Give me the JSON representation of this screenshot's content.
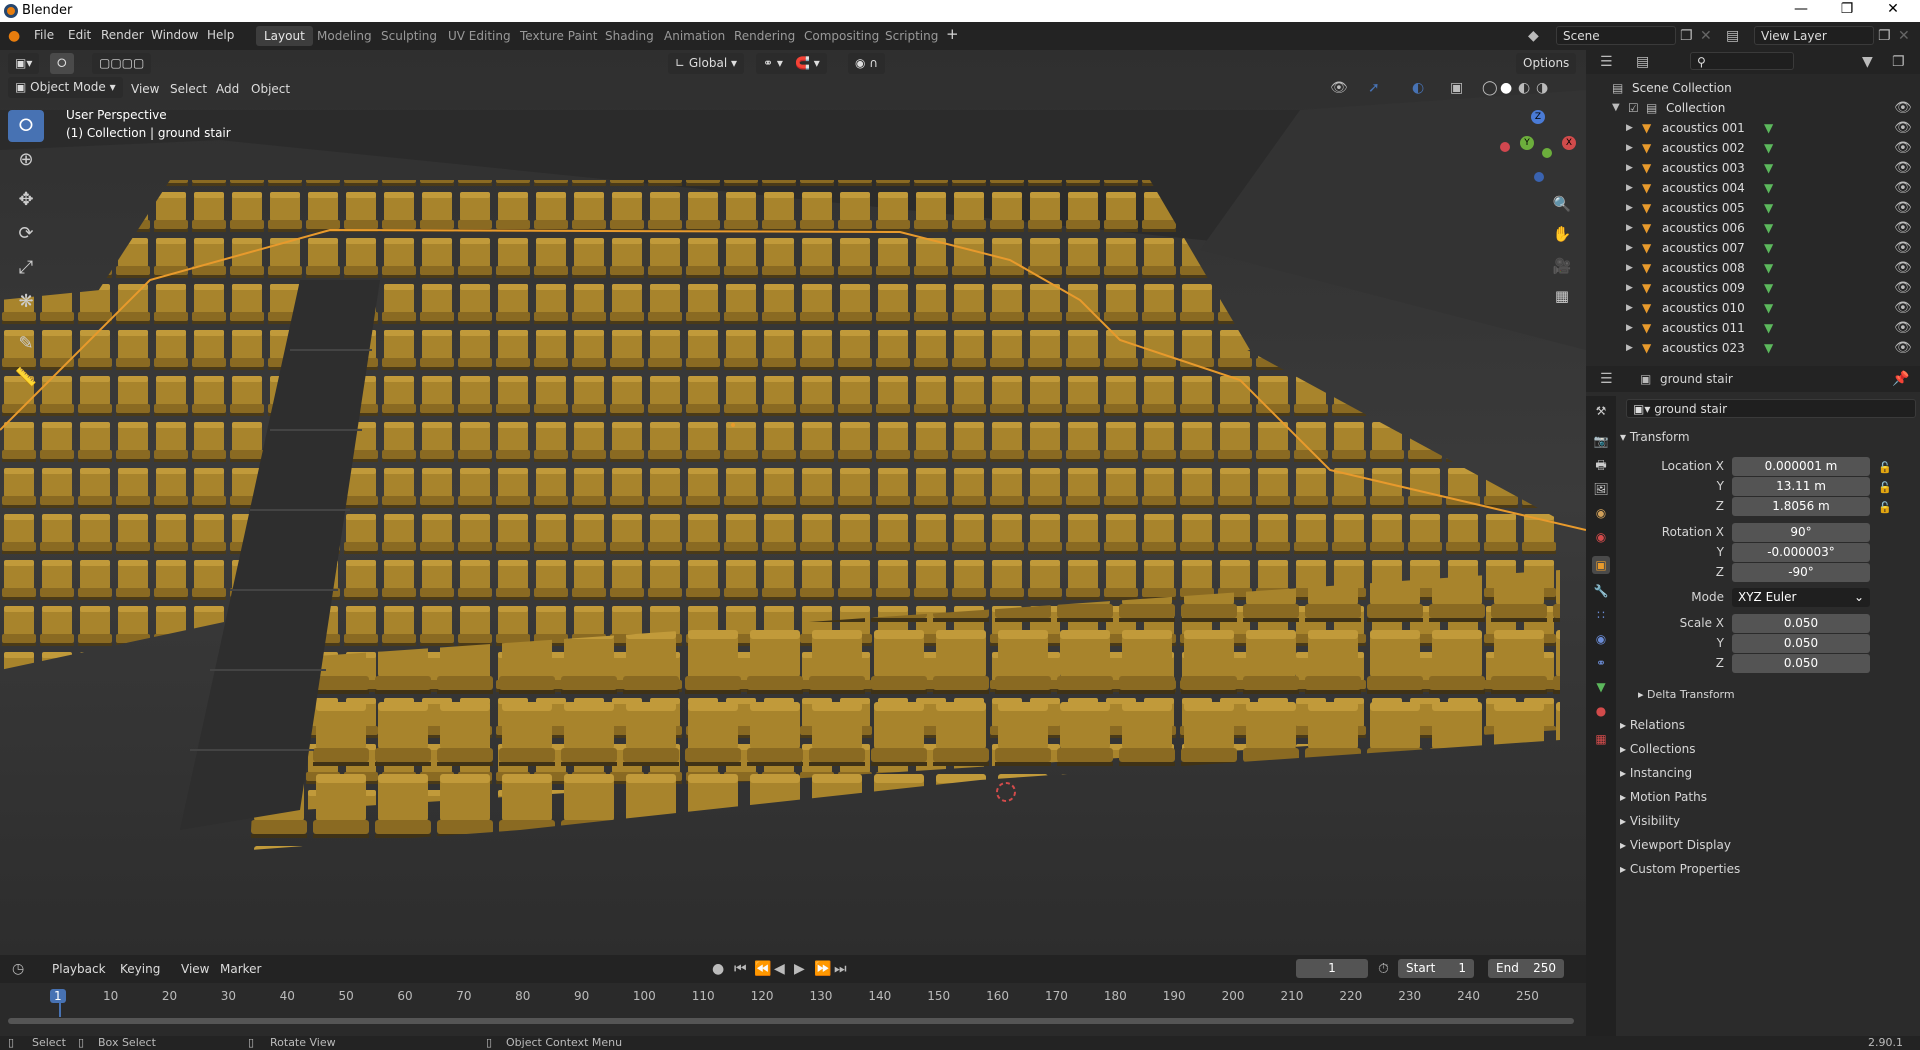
{
  "titlebar": {
    "title": "Blender"
  },
  "menu": {
    "items": [
      "File",
      "Edit",
      "Render",
      "Window",
      "Help"
    ],
    "workspaces": [
      "Layout",
      "Modeling",
      "Sculpting",
      "UV Editing",
      "Texture Paint",
      "Shading",
      "Animation",
      "Rendering",
      "Compositing",
      "Scripting"
    ],
    "add_tab": "+",
    "scene": "Scene",
    "view_layer": "View Layer"
  },
  "viewport": {
    "mode": "Object Mode",
    "menus": [
      "View",
      "Select",
      "Add",
      "Object"
    ],
    "orientation": "Global",
    "options": "Options",
    "overlay_line1": "User Perspective",
    "overlay_line2": "(1) Collection | ground stair",
    "gizmo": {
      "x": "X",
      "y": "Y",
      "z": "Z"
    }
  },
  "outliner": {
    "root": "Scene Collection",
    "collection": "Collection",
    "items": [
      "acoustics 001",
      "acoustics 002",
      "acoustics 003",
      "acoustics 004",
      "acoustics 005",
      "acoustics 006",
      "acoustics 007",
      "acoustics 008",
      "acoustics 009",
      "acoustics 010",
      "acoustics 011",
      "acoustics 023"
    ]
  },
  "properties": {
    "header_object": "ground stair",
    "object_name": "ground stair",
    "transform_title": "Transform",
    "location": {
      "label": "Location X",
      "x": "0.000001 m",
      "y_label": "Y",
      "y": "13.11 m",
      "z_label": "Z",
      "z": "1.8056 m"
    },
    "rotation": {
      "label": "Rotation X",
      "x": "90°",
      "y_label": "Y",
      "y": "-0.000003°",
      "z_label": "Z",
      "z": "-90°"
    },
    "mode": {
      "label": "Mode",
      "value": "XYZ Euler"
    },
    "scale": {
      "label": "Scale X",
      "x": "0.050",
      "y_label": "Y",
      "y": "0.050",
      "z_label": "Z",
      "z": "0.050"
    },
    "delta": "Delta Transform",
    "sections": [
      "Relations",
      "Collections",
      "Instancing",
      "Motion Paths",
      "Visibility",
      "Viewport Display",
      "Custom Properties"
    ]
  },
  "timeline": {
    "menus": [
      "Playback",
      "Keying",
      "View",
      "Marker"
    ],
    "current_frame": "1",
    "start_label": "Start",
    "start": "1",
    "end_label": "End",
    "end": "250",
    "ticks": [
      "1",
      "10",
      "20",
      "30",
      "40",
      "50",
      "60",
      "70",
      "80",
      "90",
      "100",
      "110",
      "120",
      "130",
      "140",
      "150",
      "160",
      "170",
      "180",
      "190",
      "200",
      "210",
      "220",
      "230",
      "240",
      "250"
    ]
  },
  "status": {
    "select": "Select",
    "box_select": "Box Select",
    "rotate_view": "Rotate View",
    "context_menu": "Object Context Menu",
    "version": "2.90.1"
  },
  "colors": {
    "accent": "#4772b3",
    "seat": "#a8842c",
    "selection": "#e89a2c"
  }
}
